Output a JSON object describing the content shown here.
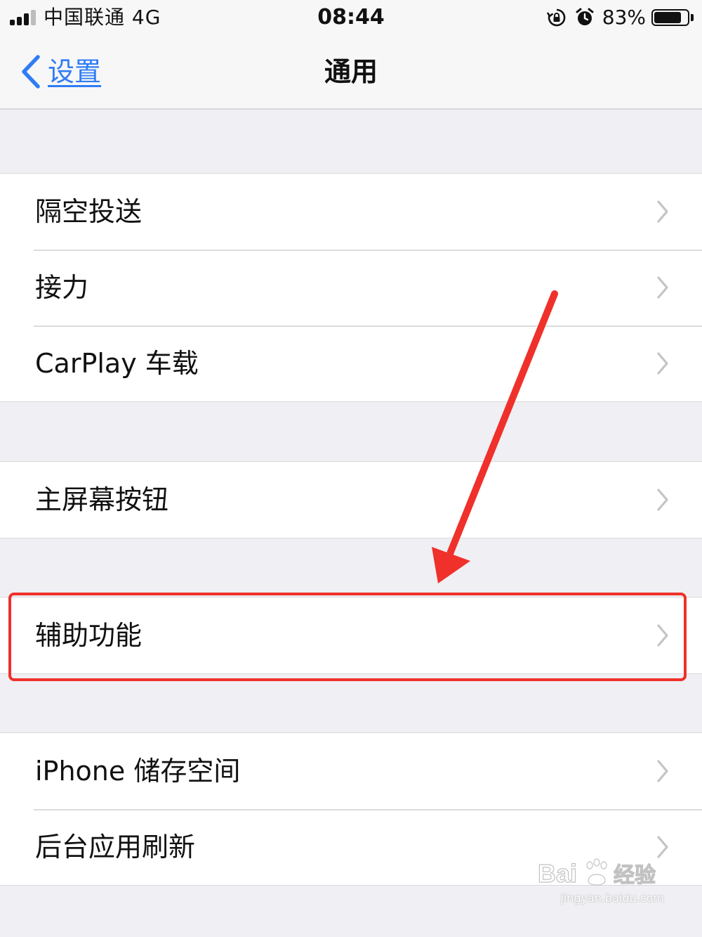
{
  "status_bar": {
    "carrier": "中国联通  4G",
    "time": "08:44",
    "battery_percent": "83%",
    "battery_level": 0.83,
    "icons": [
      "signal-icon",
      "rotation-lock-icon",
      "alarm-icon",
      "battery-icon"
    ]
  },
  "nav": {
    "back_label": "设置",
    "title": "通用"
  },
  "groups": [
    {
      "items": [
        {
          "label": "隔空投送"
        },
        {
          "label": "接力"
        },
        {
          "label": "CarPlay 车载"
        }
      ]
    },
    {
      "items": [
        {
          "label": "主屏幕按钮"
        }
      ]
    },
    {
      "items": [
        {
          "label": "辅助功能"
        }
      ]
    },
    {
      "items": [
        {
          "label": "iPhone 储存空间"
        },
        {
          "label": "后台应用刷新"
        }
      ]
    }
  ],
  "annotation": {
    "highlighted_item": "辅助功能",
    "color": "#f0302a"
  },
  "watermark": {
    "logo_text": "Bai 经验",
    "url": "jingyan.baidu.com"
  },
  "colors": {
    "accent": "#2f7cf6",
    "background": "#efeff4",
    "chevron": "#c4c4c7"
  }
}
